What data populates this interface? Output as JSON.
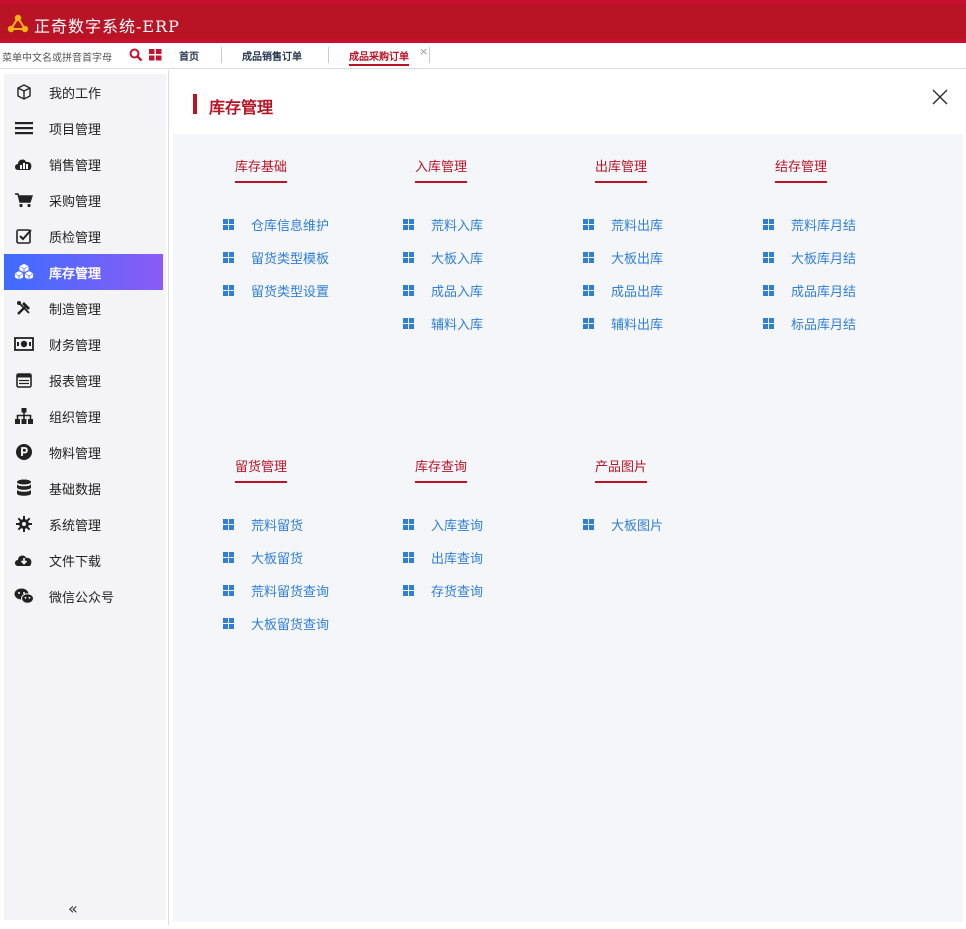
{
  "header": {
    "title": "正奇数字系统-ERP"
  },
  "tabbar": {
    "search_placeholder": "菜单中文名或拼音首字母",
    "tabs": [
      {
        "label": "首页"
      },
      {
        "label": "成品销售订单"
      },
      {
        "label": "成品采购订单",
        "active": true,
        "close": "×"
      }
    ]
  },
  "sidebar": {
    "items": [
      {
        "label": "我的工作",
        "icon": "cube-icon"
      },
      {
        "label": "项目管理",
        "icon": "list-icon"
      },
      {
        "label": "销售管理",
        "icon": "cloud-chart-icon"
      },
      {
        "label": "采购管理",
        "icon": "cart-icon"
      },
      {
        "label": "质检管理",
        "icon": "checkbox-icon"
      },
      {
        "label": "库存管理",
        "icon": "boxes-icon",
        "active": true
      },
      {
        "label": "制造管理",
        "icon": "tools-icon"
      },
      {
        "label": "财务管理",
        "icon": "money-icon"
      },
      {
        "label": "报表管理",
        "icon": "calendar-icon"
      },
      {
        "label": "组织管理",
        "icon": "org-icon"
      },
      {
        "label": "物料管理",
        "icon": "parking-icon"
      },
      {
        "label": "基础数据",
        "icon": "database-icon"
      },
      {
        "label": "系统管理",
        "icon": "gear-icon"
      },
      {
        "label": "文件下载",
        "icon": "cloud-download-icon"
      },
      {
        "label": "微信公众号",
        "icon": "wechat-icon"
      }
    ],
    "collapse": "«"
  },
  "main": {
    "title": "库存管理",
    "groups": [
      {
        "title": "库存基础",
        "links": [
          "仓库信息维护",
          "留货类型模板",
          "留货类型设置"
        ]
      },
      {
        "title": "入库管理",
        "links": [
          "荒料入库",
          "大板入库",
          "成品入库",
          "辅料入库"
        ]
      },
      {
        "title": "出库管理",
        "links": [
          "荒料出库",
          "大板出库",
          "成品出库",
          "辅料出库"
        ]
      },
      {
        "title": "结存管理",
        "links": [
          "荒料库月结",
          "大板库月结",
          "成品库月结",
          "标品库月结"
        ]
      },
      {
        "title": "留货管理",
        "links": [
          "荒料留货",
          "大板留货",
          "荒料留货查询",
          "大板留货查询"
        ]
      },
      {
        "title": "库存查询",
        "links": [
          "入库查询",
          "出库查询",
          "存货查询"
        ]
      },
      {
        "title": "产品图片",
        "links": [
          "大板图片"
        ]
      }
    ]
  },
  "colors": {
    "brand": "#b81426",
    "link": "#2f7fd6",
    "active_start": "#3e6cff",
    "active_end": "#8a5cf5"
  }
}
